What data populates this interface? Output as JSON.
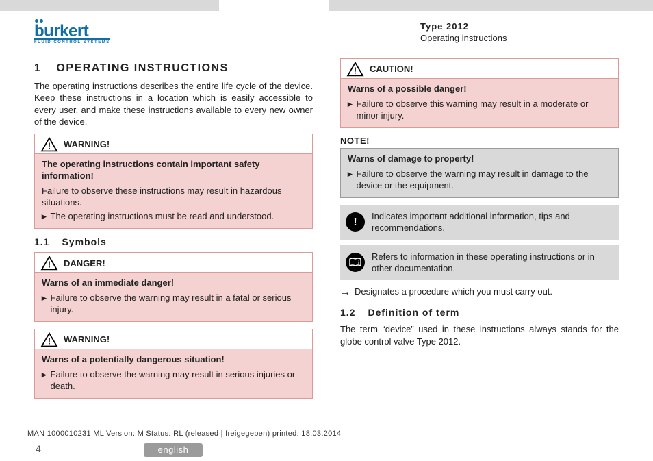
{
  "header": {
    "brand": "burkert",
    "brand_tag": "FLUID CONTROL SYSTEMS",
    "doc_type": "Type 2012",
    "doc_title": "Operating instructions"
  },
  "left": {
    "h1_num": "1",
    "h1_text": "OPERATING INSTRUCTIONS",
    "intro": "The operating instructions describes the entire life cycle of the device. Keep these instructions in a location which is easily accessible to every user, and make these instructions available to every new owner of the device.",
    "warning1": {
      "label": "WARNING!",
      "lead": "The operating instructions contain important safety information!",
      "plain": "Failure to observe these instructions may result in hazardous situations.",
      "bullet": "The operating instructions must be read and understood."
    },
    "h2_num": "1.1",
    "h2_text": "Symbols",
    "danger": {
      "label": "DANGER!",
      "lead": "Warns of an immediate danger!",
      "bullet": "Failure to observe the warning may result in a fatal or serious injury."
    },
    "warning2": {
      "label": "WARNING!",
      "lead": "Warns of a potentially dangerous situation!",
      "bullet": "Failure to observe the warning may result in serious injuries or death."
    }
  },
  "right": {
    "caution": {
      "label": "CAUTION!",
      "lead": "Warns of a possible danger!",
      "bullet": "Failure to observe this warning may result in a moderate or minor injury."
    },
    "note_heading": "NOTE!",
    "note": {
      "lead": "Warns of damage to property!",
      "bullet": "Failure to observe the warning may result in damage to the device or the equipment."
    },
    "info": "Indicates important additional information, tips and recommendations.",
    "ref": "Refers to information in these operating instructions or in other documentation.",
    "procedure": "Designates a procedure which you must carry out.",
    "h2_num": "1.2",
    "h2_text": "Definition of term",
    "def": "The term “device” used in these instructions always stands for the globe control valve Type 2012."
  },
  "footer": {
    "meta": "MAN  1000010231  ML  Version: M Status: RL (released | freigegeben)  printed: 18.03.2014",
    "page": "4",
    "lang": "english"
  },
  "icons": {
    "arrow": "→",
    "bullet": "▸",
    "excl": "!",
    "book": "ℹ"
  }
}
